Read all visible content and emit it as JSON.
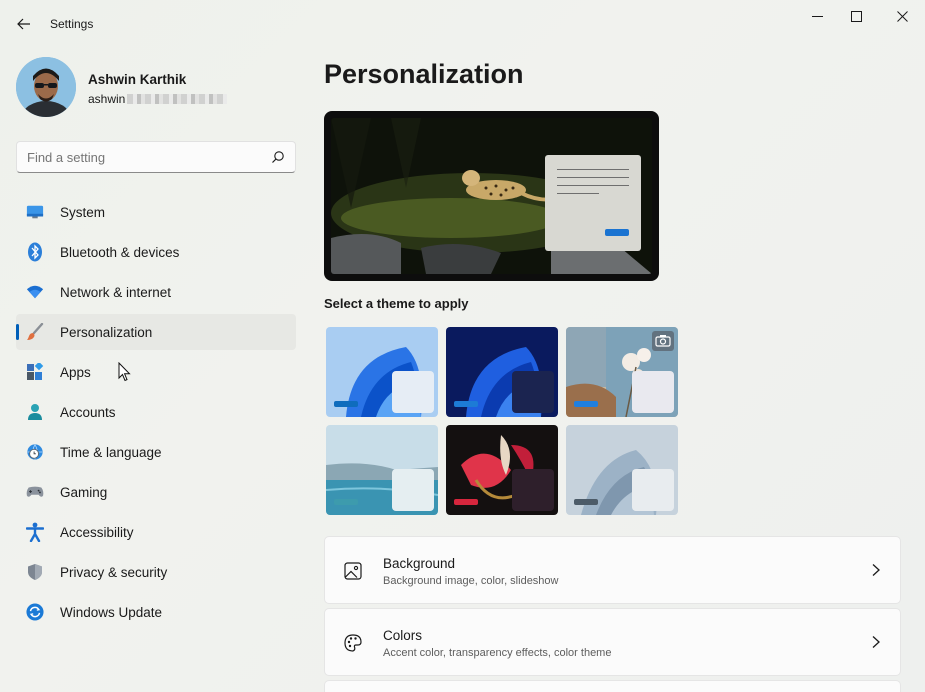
{
  "window": {
    "title": "Settings"
  },
  "profile": {
    "name": "Ashwin Karthik",
    "email_prefix": "ashwin"
  },
  "search": {
    "placeholder": "Find a setting"
  },
  "nav": {
    "items": [
      {
        "label": "System",
        "icon": "system-icon"
      },
      {
        "label": "Bluetooth & devices",
        "icon": "bluetooth-icon"
      },
      {
        "label": "Network & internet",
        "icon": "wifi-icon"
      },
      {
        "label": "Personalization",
        "icon": "brush-icon",
        "active": true
      },
      {
        "label": "Apps",
        "icon": "apps-icon"
      },
      {
        "label": "Accounts",
        "icon": "person-icon"
      },
      {
        "label": "Time & language",
        "icon": "globe-clock-icon"
      },
      {
        "label": "Gaming",
        "icon": "gamepad-icon"
      },
      {
        "label": "Accessibility",
        "icon": "accessibility-icon"
      },
      {
        "label": "Privacy & security",
        "icon": "shield-icon"
      },
      {
        "label": "Windows Update",
        "icon": "update-icon"
      }
    ]
  },
  "main": {
    "title": "Personalization",
    "themes_label": "Select a theme to apply",
    "themes": [
      {
        "name": "windows-light",
        "bg": "#9ec3ef",
        "accent": "#0f6cbd",
        "mini": "#e6edf5"
      },
      {
        "name": "windows-dark",
        "bg": "#0c1f6a",
        "accent": "#1d7bd6",
        "mini": "#1b2450"
      },
      {
        "name": "glow-spotlight",
        "bg": "#c9bda8",
        "accent": "#1f7fe0",
        "mini": "#e9e9ef"
      },
      {
        "name": "captured-motion",
        "bg": "#7fb3c4",
        "accent": "#3d9bad",
        "mini": "#e5eef1"
      },
      {
        "name": "flow",
        "bg": "#1a1414",
        "accent": "#d7263d",
        "mini": "#2e1f2b"
      },
      {
        "name": "sunrise",
        "bg": "#b8c6d3",
        "accent": "#4c5b68",
        "mini": "#e8ecef"
      }
    ],
    "cards": [
      {
        "title": "Background",
        "subtitle": "Background image, color, slideshow",
        "icon": "image-icon"
      },
      {
        "title": "Colors",
        "subtitle": "Accent color, transparency effects, color theme",
        "icon": "palette-icon"
      }
    ]
  },
  "colors": {
    "accent": "#005fb8",
    "active_nav_bg": "#e7e8e4"
  }
}
